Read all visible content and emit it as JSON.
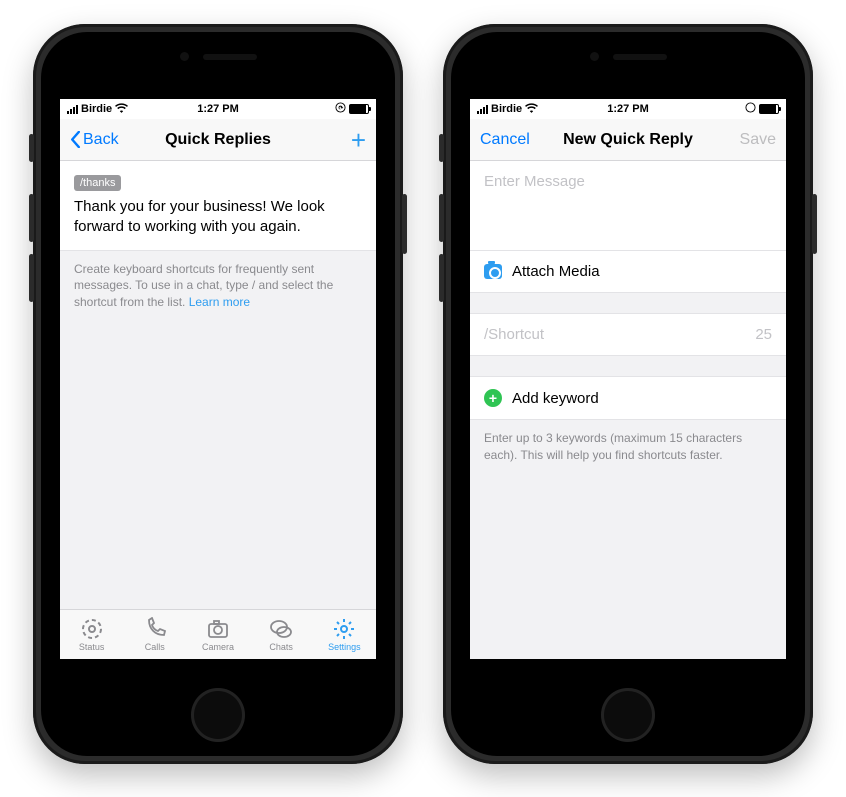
{
  "status": {
    "carrier": "Birdie",
    "time": "1:27 PM"
  },
  "left": {
    "nav": {
      "back": "Back",
      "title": "Quick Replies"
    },
    "reply": {
      "badge": "/thanks",
      "text": "Thank you for your business! We look forward to working with you again."
    },
    "hint": "Create keyboard shortcuts for frequently sent messages. To use in a chat, type / and select the shortcut from the list. ",
    "hint_link": "Learn more",
    "tabs": {
      "status": "Status",
      "calls": "Calls",
      "camera": "Camera",
      "chats": "Chats",
      "settings": "Settings"
    }
  },
  "right": {
    "nav": {
      "cancel": "Cancel",
      "title": "New Quick Reply",
      "save": "Save"
    },
    "message_placeholder": "Enter Message",
    "attach": "Attach Media",
    "shortcut": {
      "placeholder": "/Shortcut",
      "limit": "25"
    },
    "add_keyword": "Add keyword",
    "keyword_hint": "Enter up to 3 keywords (maximum 15 characters each). This will help you find shortcuts faster."
  }
}
